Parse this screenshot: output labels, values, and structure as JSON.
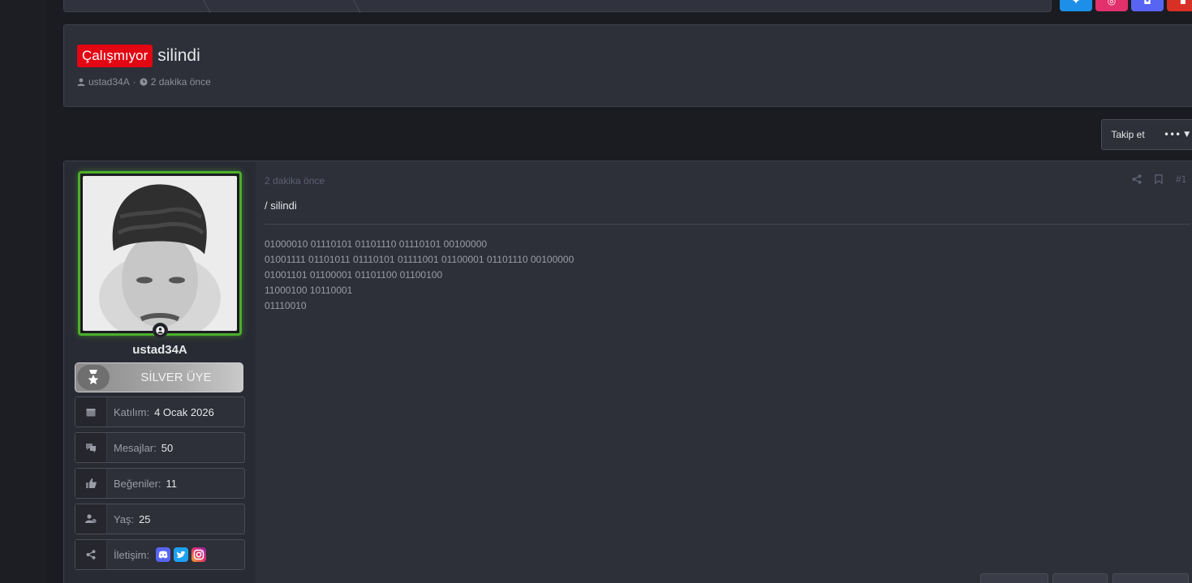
{
  "thread": {
    "prefix": "Çalışmıyor",
    "title": "silindi",
    "author": "ustad34A",
    "separator": "·",
    "time": "2 dakika önce"
  },
  "actions": {
    "follow_label": "Takip et",
    "more_label": "•••"
  },
  "user": {
    "name": "ustad34A",
    "rank": "SİLVER ÜYE",
    "stats": [
      {
        "label": "Katılım:",
        "value": "4 Ocak 2026",
        "icon": "calendar-icon"
      },
      {
        "label": "Mesajlar:",
        "value": "50",
        "icon": "messages-icon"
      },
      {
        "label": "Beğeniler:",
        "value": "11",
        "icon": "thumbs-up-icon"
      },
      {
        "label": "Yaş:",
        "value": "25",
        "icon": "user-age-icon"
      },
      {
        "label": "İletişim:",
        "value": "",
        "icon": "share-icon"
      }
    ]
  },
  "post": {
    "date": "2 dakika önce",
    "number": "#1",
    "heading": "/ silindi",
    "lines": [
      "01000010 01110101 01101110 01110101 00100000",
      "01001111 01101011 01110101 01111001 01100001 01101110 00100000",
      "01001101 01100001 01101100 01100100",
      "11000100 10110001",
      "01110010"
    ]
  },
  "colors": {
    "prefix_bg": "#e30613",
    "avatar_border": "#4caf2a",
    "discord": "#5865f2",
    "twitter": "#1da1f2",
    "instagram": "#e1306c"
  }
}
